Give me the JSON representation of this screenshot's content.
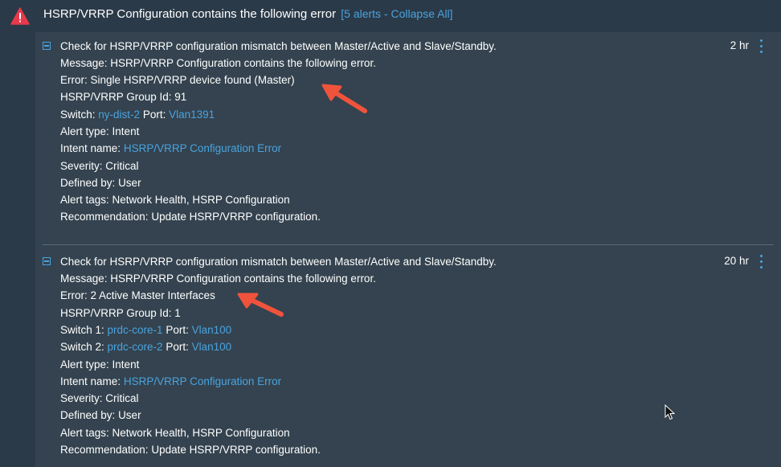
{
  "header": {
    "title": "HSRP/VRRP Configuration contains the following error",
    "count_label": "[5 alerts",
    "separator": " - ",
    "collapse_all": "Collapse All]"
  },
  "alerts": [
    {
      "check": "Check for HSRP/VRRP configuration mismatch between Master/Active and Slave/Standby.",
      "time": "2 hr",
      "message": "Message: HSRP/VRRP Configuration contains the following error.",
      "error": "Error: Single HSRP/VRRP device found (Master)",
      "group_id": "HSRP/VRRP Group Id: 91",
      "switch_label": "Switch:",
      "switch_name": "ny-dist-2",
      "port_label": "Port:",
      "port_name": "Vlan1391",
      "alert_type_label": "Alert type:",
      "alert_type": "Intent",
      "intent_label": "Intent name:",
      "intent_name": "HSRP/VRRP Configuration Error",
      "severity_label": "Severity:",
      "severity": "Critical",
      "defined_label": "Defined by:",
      "defined_by": "User",
      "tags_label": "Alert tags:",
      "tags": "Network Health, HSRP Configuration",
      "rec_label": "Recommendation:",
      "recommendation": "Update HSRP/VRRP configuration."
    },
    {
      "check": "Check for HSRP/VRRP configuration mismatch between Master/Active and Slave/Standby.",
      "time": "20 hr",
      "message": "Message: HSRP/VRRP Configuration contains the following error.",
      "error": "Error: 2 Active Master Interfaces",
      "group_id": "HSRP/VRRP Group Id: 1",
      "switch1_label": "Switch 1:",
      "switch1_name": "prdc-core-1",
      "port1_label": "Port:",
      "port1_name": "Vlan100",
      "switch2_label": "Switch 2:",
      "switch2_name": "prdc-core-2",
      "port2_label": "Port:",
      "port2_name": "Vlan100",
      "alert_type_label": "Alert type:",
      "alert_type": "Intent",
      "intent_label": "Intent name:",
      "intent_name": "HSRP/VRRP Configuration Error",
      "severity_label": "Severity:",
      "severity": "Critical",
      "defined_label": "Defined by:",
      "defined_by": "User",
      "tags_label": "Alert tags:",
      "tags": "Network Health, HSRP Configuration",
      "rec_label": "Recommendation:",
      "recommendation": "Update HSRP/VRRP configuration."
    }
  ],
  "colors": {
    "background": "#2b3a48",
    "panel": "#34434f",
    "link": "#4aa3df",
    "warning": "#e8394a",
    "annotation_arrow": "#f0533c"
  },
  "icons": {
    "header": "warning-triangle-icon",
    "alert_toggle": "collapse-minus-icon",
    "alert_menu": "kebab-menu-icon",
    "pointer": "mouse-cursor-icon"
  }
}
